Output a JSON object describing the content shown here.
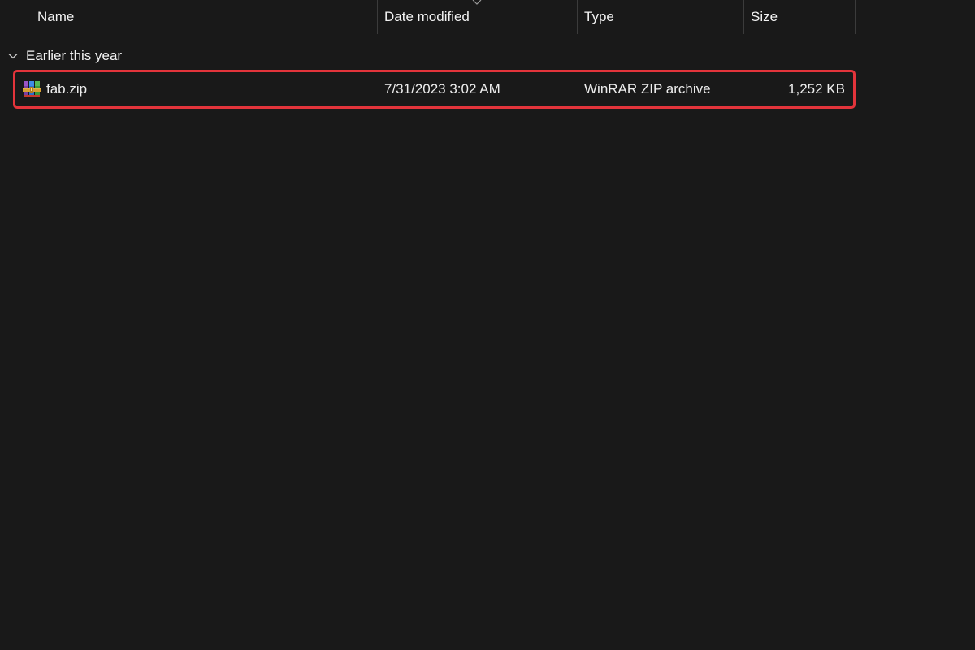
{
  "columns": {
    "name": "Name",
    "date": "Date modified",
    "type": "Type",
    "size": "Size"
  },
  "group": {
    "label": "Earlier this year",
    "expanded": true
  },
  "files": [
    {
      "name": "fab.zip",
      "date_modified": "7/31/2023 3:02 AM",
      "type": "WinRAR ZIP archive",
      "size": "1,252 KB",
      "icon": "winrar-archive-icon",
      "highlighted": true
    }
  ],
  "colors": {
    "background": "#191919",
    "text": "#f2f2f2",
    "highlight_border": "#e3343b",
    "divider": "#3b3b3b"
  }
}
